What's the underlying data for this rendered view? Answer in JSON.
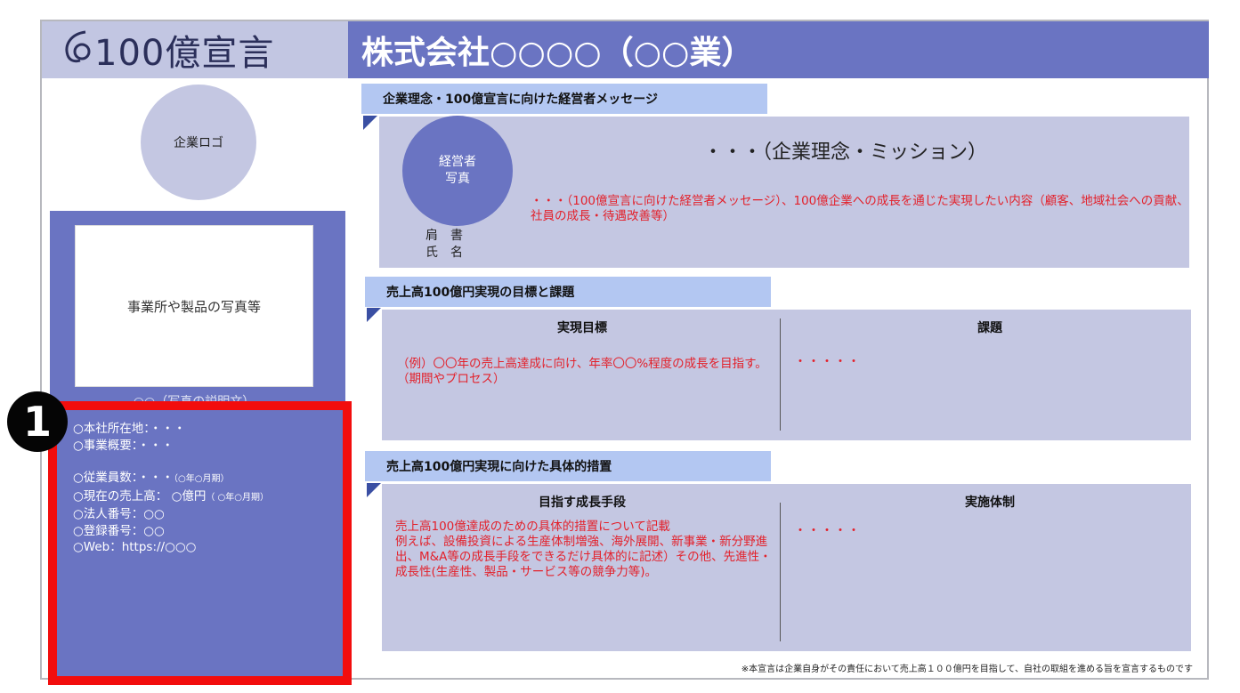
{
  "header": {
    "brand": "100億宣言",
    "title": "株式会社○○○○（○○業）"
  },
  "left": {
    "logo_placeholder": "企業ロゴ",
    "photo_placeholder": "事業所や製品の写真等",
    "photo_caption": "○○（写真の説明文）",
    "badge": "1",
    "info": {
      "address": "○本社所在地：・・・",
      "business": "○事業概要：・・・",
      "employees": "○従業員数：・・・",
      "employees_note": "（○年○月期）",
      "sales": "○現在の売上高： ○億円",
      "sales_note": "（ ○年○月期）",
      "corp_number": "○法人番号：○○",
      "reg_number": "○登録番号：○○",
      "web": "○Web：https://○○○"
    }
  },
  "section1": {
    "heading": "企業理念・100億宣言に向けた経営者メッセージ",
    "exec_photo": "経営者\n写真",
    "exec_title": "肩　書",
    "exec_name": "氏　名",
    "mission": "・・・（企業理念・ミッション）",
    "message": "・・・（100億宣言に向けた経営者メッセージ）、100億企業への成長を通じた実現したい内容（顧客、地域社会への貢献、社員の成長・待遇改善等）"
  },
  "section2": {
    "heading": "売上高100億円実現の目標と課題",
    "left_head": "実現目標",
    "left_text": "（例）〇〇年の売上高達成に向け、年率〇〇%程度の成長を目指す。（期間やプロセス）",
    "right_head": "課題",
    "right_text": "・・・・・"
  },
  "section3": {
    "heading": "売上高100億円実現に向けた具体的措置",
    "left_head": "目指す成長手段",
    "left_text": "売上高100億達成のための具体的措置について記載\n例えば、設備投資による生産体制増強、海外展開、新事業・新分野進出、M&A等の成長手段をできるだけ具体的に記述）その他、先進性・成長性(生産性、製品・サービス等の競争力等)。",
    "right_head": "実施体制",
    "right_text": "・・・・・"
  },
  "footnote": "※本宣言は企業自身がその責任において売上高１００億円を目指して、自社の取組を進める旨を宣言するものです",
  "colors": {
    "header_dark": "#6a74c2",
    "header_light": "#c2c6e2",
    "panel_light": "#c4c7e2",
    "tab_blue": "#b3c7f2",
    "highlight_red": "#f20d0d",
    "text_red": "#e3212b"
  }
}
